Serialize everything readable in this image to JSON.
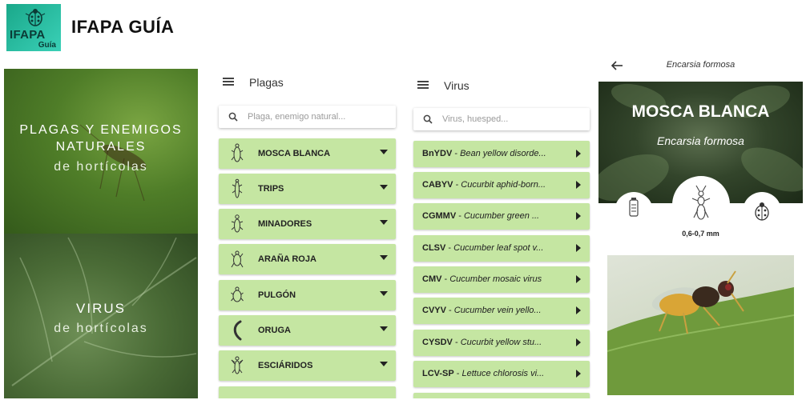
{
  "header": {
    "logo_text": "IFAPA",
    "logo_subtext": "Guía",
    "app_title": "IFAPA GUÍA"
  },
  "home": {
    "tile_plagas": {
      "line1": "PLAGAS Y ENEMIGOS",
      "line2": "NATURALES",
      "line3": "de hortícolas"
    },
    "tile_virus": {
      "line1": "VIRUS",
      "line2": "de hortícolas"
    }
  },
  "plagas": {
    "title": "Plagas",
    "search_placeholder": "Plaga, enemigo natural...",
    "items": [
      {
        "label": "MOSCA BLANCA",
        "icon": "whitefly-icon"
      },
      {
        "label": "TRIPS",
        "icon": "thrips-icon"
      },
      {
        "label": "MINADORES",
        "icon": "leafminer-icon"
      },
      {
        "label": "ARAÑA ROJA",
        "icon": "spider-mite-icon"
      },
      {
        "label": "PULGÓN",
        "icon": "aphid-icon"
      },
      {
        "label": "ORUGA",
        "icon": "caterpillar-icon"
      },
      {
        "label": "ESCIÁRIDOS",
        "icon": "sciarid-icon"
      }
    ]
  },
  "virus": {
    "title": "Virus",
    "search_placeholder": "Virus, huesped...",
    "items": [
      {
        "code": "BnYDV",
        "name": "Bean yellow disorde..."
      },
      {
        "code": "CABYV",
        "name": "Cucurbit aphid-born..."
      },
      {
        "code": "CGMMV",
        "name": "Cucumber green ..."
      },
      {
        "code": "CLSV",
        "name": "Cucumber leaf spot v..."
      },
      {
        "code": "CMV",
        "name": "Cucumber mosaic virus"
      },
      {
        "code": "CVYV",
        "name": "Cucumber vein yello..."
      },
      {
        "code": "CYSDV",
        "name": "Cucurbit yellow stu..."
      },
      {
        "code": "LCV-SP",
        "name": "Lettuce chlorosis vi..."
      }
    ]
  },
  "detail": {
    "top_title": "Encarsia formosa",
    "hero_title": "MOSCA BLANCA",
    "hero_subtitle": "Encarsia formosa",
    "size": "0,6-0,7 mm",
    "icons": {
      "left": "bottle-icon",
      "middle": "wasp-icon",
      "right": "ladybug-icon"
    }
  },
  "colors": {
    "row_green": "#c5e6a2",
    "logo_teal": "#1aa88a"
  }
}
